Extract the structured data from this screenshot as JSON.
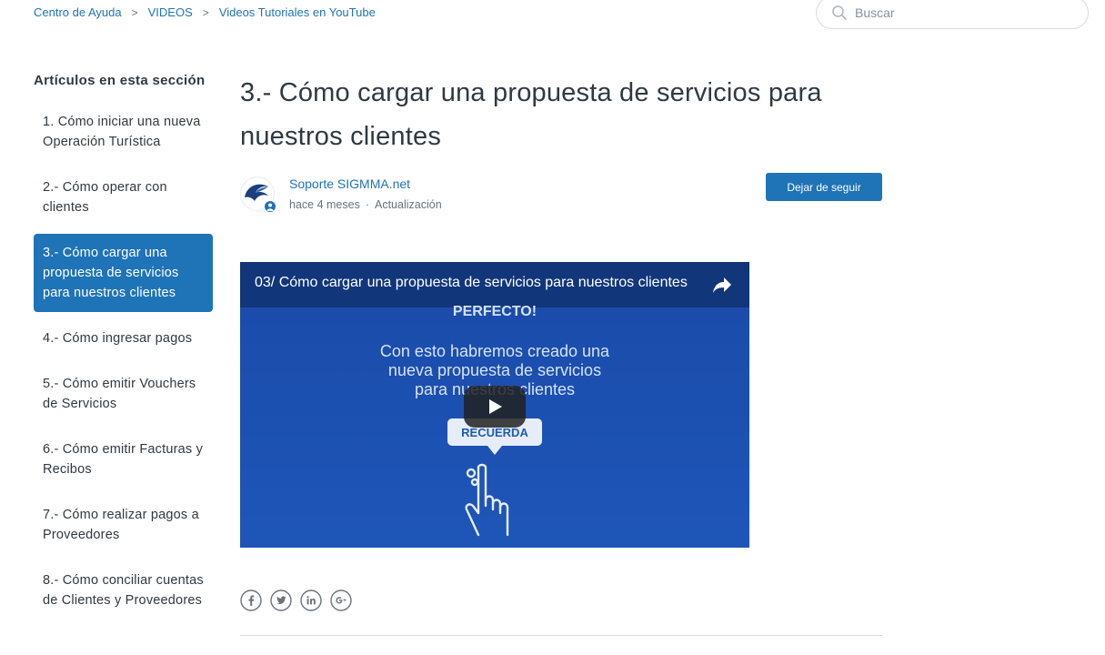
{
  "breadcrumb": {
    "items": [
      "Centro de Ayuda",
      "VIDEOS",
      "Videos Tutoriales en YouTube"
    ],
    "separator": ">"
  },
  "search": {
    "placeholder": "Buscar"
  },
  "sidebar": {
    "title": "Artículos en esta sección",
    "items": [
      {
        "label": "1. Cómo iniciar una nueva Operación Turística",
        "active": false
      },
      {
        "label": "2.- Cómo operar con clientes",
        "active": false
      },
      {
        "label": "3.- Cómo cargar una propuesta de servicios para nuestros clientes",
        "active": true
      },
      {
        "label": "4.- Cómo ingresar pagos",
        "active": false
      },
      {
        "label": "5.- Cómo emitir Vouchers de Servicios",
        "active": false
      },
      {
        "label": "6.- Cómo emitir Facturas y Recibos",
        "active": false
      },
      {
        "label": "7.- Cómo realizar pagos a Proveedores",
        "active": false
      },
      {
        "label": "8.- Cómo conciliar cuentas de Clientes y Proveedores",
        "active": false
      }
    ]
  },
  "article": {
    "title": "3.- Cómo cargar una propuesta de servicios para nuestros clientes",
    "author": "Soporte SIGMMA.net",
    "time_ago": "hace 4 meses",
    "update_label": "Actualización",
    "follow_label": "Dejar de seguir"
  },
  "video": {
    "title": "03/ Cómo cargar una propuesta de servicios para nuestros clientes",
    "slide_heading": "PERFECTO!",
    "slide_lines": [
      "Con esto habremos creado una",
      "nueva propuesta de servicios",
      "para nuestros clientes"
    ],
    "bubble_label": "RECUERDA"
  },
  "social": [
    "facebook-icon",
    "twitter-icon",
    "linkedin-icon",
    "google-plus-icon"
  ],
  "colors": {
    "accent": "#1f73b7",
    "video_bg": "#1b4fb0",
    "text": "#2f3941"
  }
}
